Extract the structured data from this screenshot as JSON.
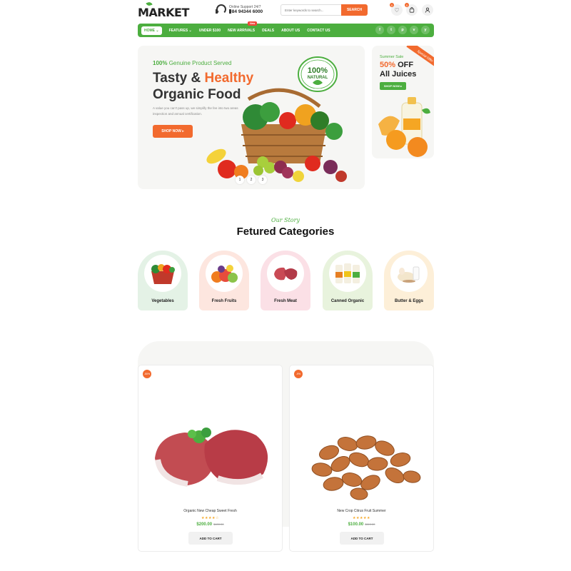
{
  "header": {
    "logo": "MARKET",
    "support_label": "Online Support 24/7",
    "support_phone": "+84 94344 6000",
    "search_placeholder": "Enter keywords to search...",
    "search_button": "SEARCH",
    "wishlist_count": "0",
    "cart_count": "0"
  },
  "nav": {
    "items": [
      "HOME",
      "FEATURES",
      "UNDER $100",
      "NEW ARRIVALS",
      "DEALS",
      "ABOUT US",
      "CONTACT US"
    ],
    "new_badge": "New",
    "socials": [
      "f",
      "t",
      "p",
      "v",
      "y"
    ]
  },
  "hero": {
    "tag_bold": "100%",
    "tag_rest": " Genuine Product Served",
    "title_1": "Tasty & ",
    "title_highlight": "Healthy",
    "title_2": "Organic Food",
    "description": "A value you can't pass up, we simplify the fee into two areas inspection and annual certification.",
    "button": "SHOP NOW",
    "seal_top": "100%",
    "seal_bottom": "NATURAL",
    "slides": [
      "1",
      "2",
      "3"
    ]
  },
  "promo": {
    "ribbon": "Special Offer",
    "label": "Summer Sale",
    "discount": "50%",
    "off": " OFF",
    "product": "All Juices",
    "button": "SHOP NOW"
  },
  "categories": {
    "subtitle": "Our Story",
    "title": "Fetured Categories",
    "items": [
      {
        "label": "Vegetables",
        "bg": "#e4f2e6"
      },
      {
        "label": "Fresh Fruits",
        "bg": "#fde6df"
      },
      {
        "label": "Fresh Meat",
        "bg": "#fbe0e6"
      },
      {
        "label": "Canned Organic",
        "bg": "#e8f3dd"
      },
      {
        "label": "Butter & Eggs",
        "bg": "#fdefd8"
      }
    ]
  },
  "products": [
    {
      "discount": "-50%",
      "name": "Organic New Cheap Sweet Fresh",
      "stars": "★★★★☆",
      "price": "$200.00",
      "old_price": "$400.00",
      "button": "ADD TO CART"
    },
    {
      "discount": "-9%",
      "name": "New Crop Citrus Fruit Summer",
      "stars": "★★★★★",
      "price": "$100.00",
      "old_price": "$110.00",
      "button": "ADD TO CART"
    }
  ],
  "colors": {
    "green": "#4cae3f",
    "orange": "#f26a2e"
  }
}
